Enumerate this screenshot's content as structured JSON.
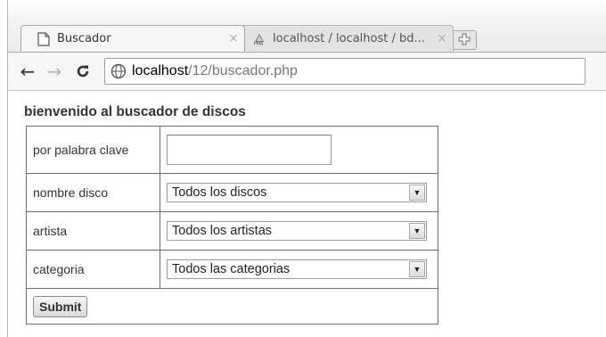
{
  "browser": {
    "tabs": [
      {
        "title": "Buscador",
        "close_glyph": "×",
        "icon": "page-icon",
        "active": true
      },
      {
        "title": "localhost / localhost / bd...",
        "close_glyph": "×",
        "icon": "pma-icon",
        "active": false
      }
    ],
    "new_tab_icon": "new-tab-icon",
    "toolbar": {
      "back_glyph": "←",
      "forward_glyph": "→",
      "reload_glyph": "C"
    },
    "address": {
      "host": "localhost",
      "path": "/12/buscador.php",
      "icon": "globe-icon"
    }
  },
  "page": {
    "heading": "bienvenido al buscador de discos",
    "form": {
      "keyword_label": "por palabra clave",
      "keyword_value": "",
      "disc_label": "nombre disco",
      "disc_selected": "Todos los discos",
      "artist_label": "artista",
      "artist_selected": "Todos los artistas",
      "category_label": "categoria",
      "category_selected": "Todos las categorias",
      "submit_label": "Submit"
    }
  }
}
